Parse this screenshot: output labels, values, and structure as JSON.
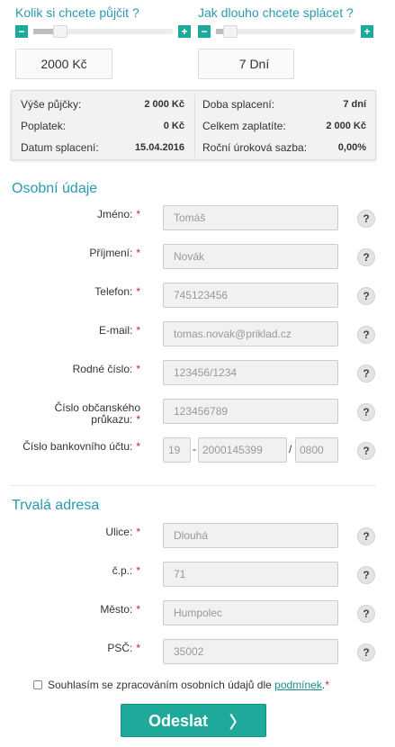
{
  "sliders": {
    "amount": {
      "title": "Kolik si chcete půjčit ?",
      "minus": "−",
      "plus": "+",
      "level_percent": 14,
      "value": "2000 Kč"
    },
    "duration": {
      "title": "Jak dlouho chcete splácet ?",
      "minus": "−",
      "plus": "+",
      "level_percent": 5,
      "value": "7 Dní"
    }
  },
  "summary": {
    "loan_amount_label": "Výše půjčky:",
    "loan_amount_value": "2 000 Kč",
    "fee_label": "Poplatek:",
    "fee_value": "0 Kč",
    "due_date_label": "Datum splacení:",
    "due_date_value": "15.04.2016",
    "period_label": "Doba splacení:",
    "period_value": "7 dní",
    "total_label": "Celkem zaplatíte:",
    "total_value": "2 000 Kč",
    "rate_label": "Roční úroková sazba:",
    "rate_value": "0,00%"
  },
  "personal": {
    "title": "Osobní údaje",
    "help": "?",
    "required_mark": "*",
    "fields": [
      {
        "label": "Jméno:",
        "value": "Tomáš"
      },
      {
        "label": "Příjmení:",
        "value": "Novák"
      },
      {
        "label": "Telefon:",
        "value": "745123456"
      },
      {
        "label": "E-mail:",
        "value": "tomas.novak@priklad.cz"
      },
      {
        "label": "Rodné číslo:",
        "value": "123456/1234"
      },
      {
        "label_line1": "Číslo občanského",
        "label_line2": "průkazu:",
        "value": "123456789"
      },
      {
        "label": "Číslo bankovního účtu:",
        "prefix": "19",
        "dash": "-",
        "number": "2000145399",
        "slash": "/",
        "bank_code": "0800"
      }
    ]
  },
  "address": {
    "title": "Trvalá adresa",
    "fields": [
      {
        "label": "Ulice:",
        "value": "Dlouhá"
      },
      {
        "label": "č.p.:",
        "value": "71"
      },
      {
        "label": "Město:",
        "value": "Humpolec"
      },
      {
        "label": "PSČ:",
        "value": "35002"
      }
    ]
  },
  "consent": {
    "text": "Souhlasím se zpracováním osobních údajů dle ",
    "link": "podmínek",
    "suffix": ".",
    "required_mark": "*"
  },
  "submit": {
    "label": "Odeslat",
    "arrow": "〉"
  },
  "colors": {
    "accent": "#2a9ab0",
    "button": "#1ea99a",
    "required": "#cc2222"
  }
}
